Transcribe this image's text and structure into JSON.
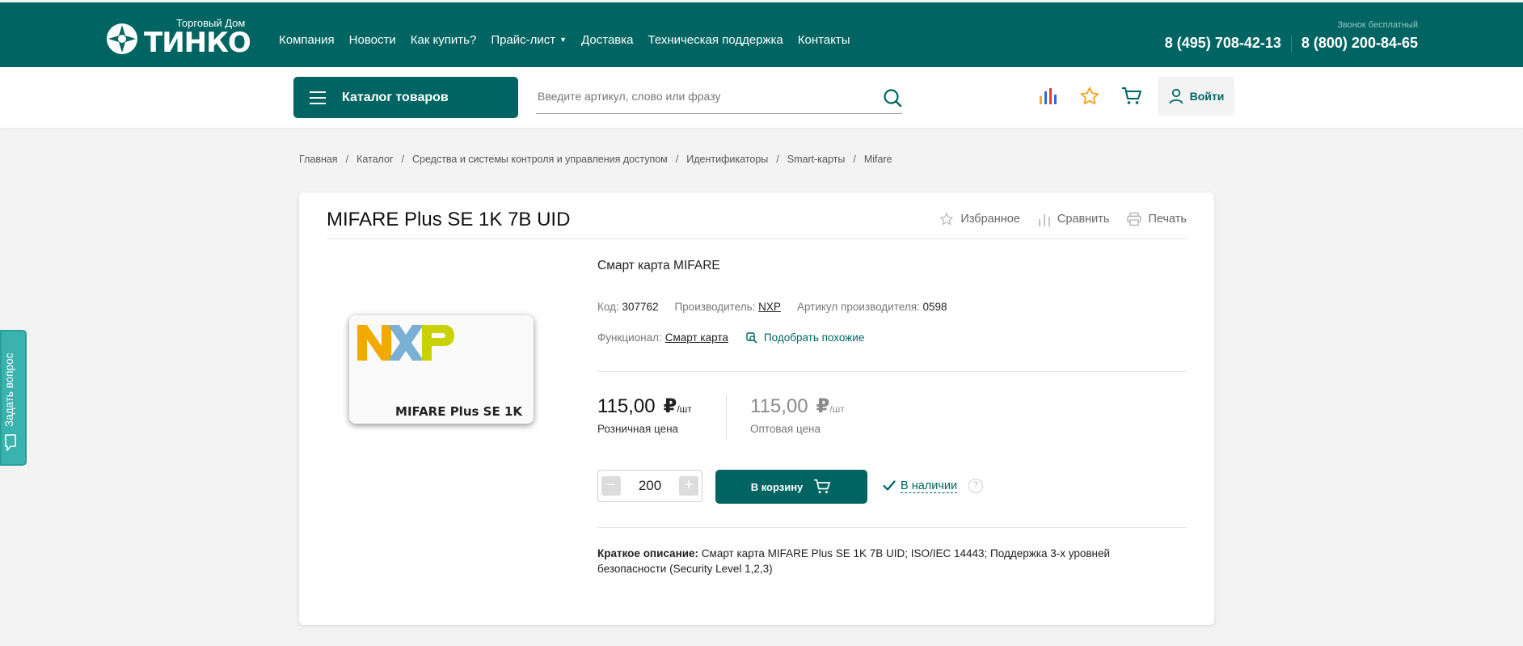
{
  "header": {
    "logo_sub": "Торговый Дом",
    "logo_word": "ТИНКО",
    "nav": [
      {
        "label": "Компания"
      },
      {
        "label": "Новости"
      },
      {
        "label": "Как купить?"
      },
      {
        "label": "Прайс-лист"
      },
      {
        "label": "Доставка"
      },
      {
        "label": "Техническая поддержка"
      },
      {
        "label": "Контакты"
      }
    ],
    "free_call": "Звонок бесплатный",
    "phone1": "8 (495) 708-42-13",
    "phone2": "8 (800) 200-84-65"
  },
  "toolbar": {
    "catalog_label": "Каталог товаров",
    "search_placeholder": "Введите артикул, слово или фразу",
    "login_label": "Войти"
  },
  "breadcrumb": [
    "Главная",
    "Каталог",
    "Средства и системы контроля и управления доступом",
    "Идентификаторы",
    "Smart-карты",
    "Mifare"
  ],
  "ask_tab": "Задать вопрос",
  "product": {
    "title": "MIFARE Plus SE 1K 7B UID",
    "actions": {
      "favorite": "Избранное",
      "compare": "Сравнить",
      "print": "Печать"
    },
    "image_caption": "MIFARE Plus SE 1K",
    "subtitle": "Смарт карта MIFARE",
    "code_label": "Код:",
    "code": "307762",
    "maker_label": "Производитель:",
    "maker": "NXP",
    "article_label": "Артикул производителя:",
    "article": "0598",
    "func_label": "Функционал:",
    "func_value": "Смарт карта",
    "similar": "Подобрать похожие",
    "retail_price": "115,00",
    "retail_label": "Розничная цена",
    "wholesale_price": "115,00",
    "wholesale_label": "Оптовая цена",
    "currency": "₽",
    "unit": "/шт",
    "qty": "200",
    "qty_minus": "−",
    "qty_plus": "+",
    "cart_label": "В корзину",
    "stock": "В наличии",
    "help": "?",
    "desc_label": "Краткое описание:",
    "desc_text": " Смарт карта MIFARE Plus SE 1K 7B UID; ISO/IEC 14443; Поддержка 3-х уровней безопасности (Security Level 1,2,3)"
  },
  "colors": {
    "brand": "#006562",
    "ask_tab": "#3ab3ae"
  }
}
